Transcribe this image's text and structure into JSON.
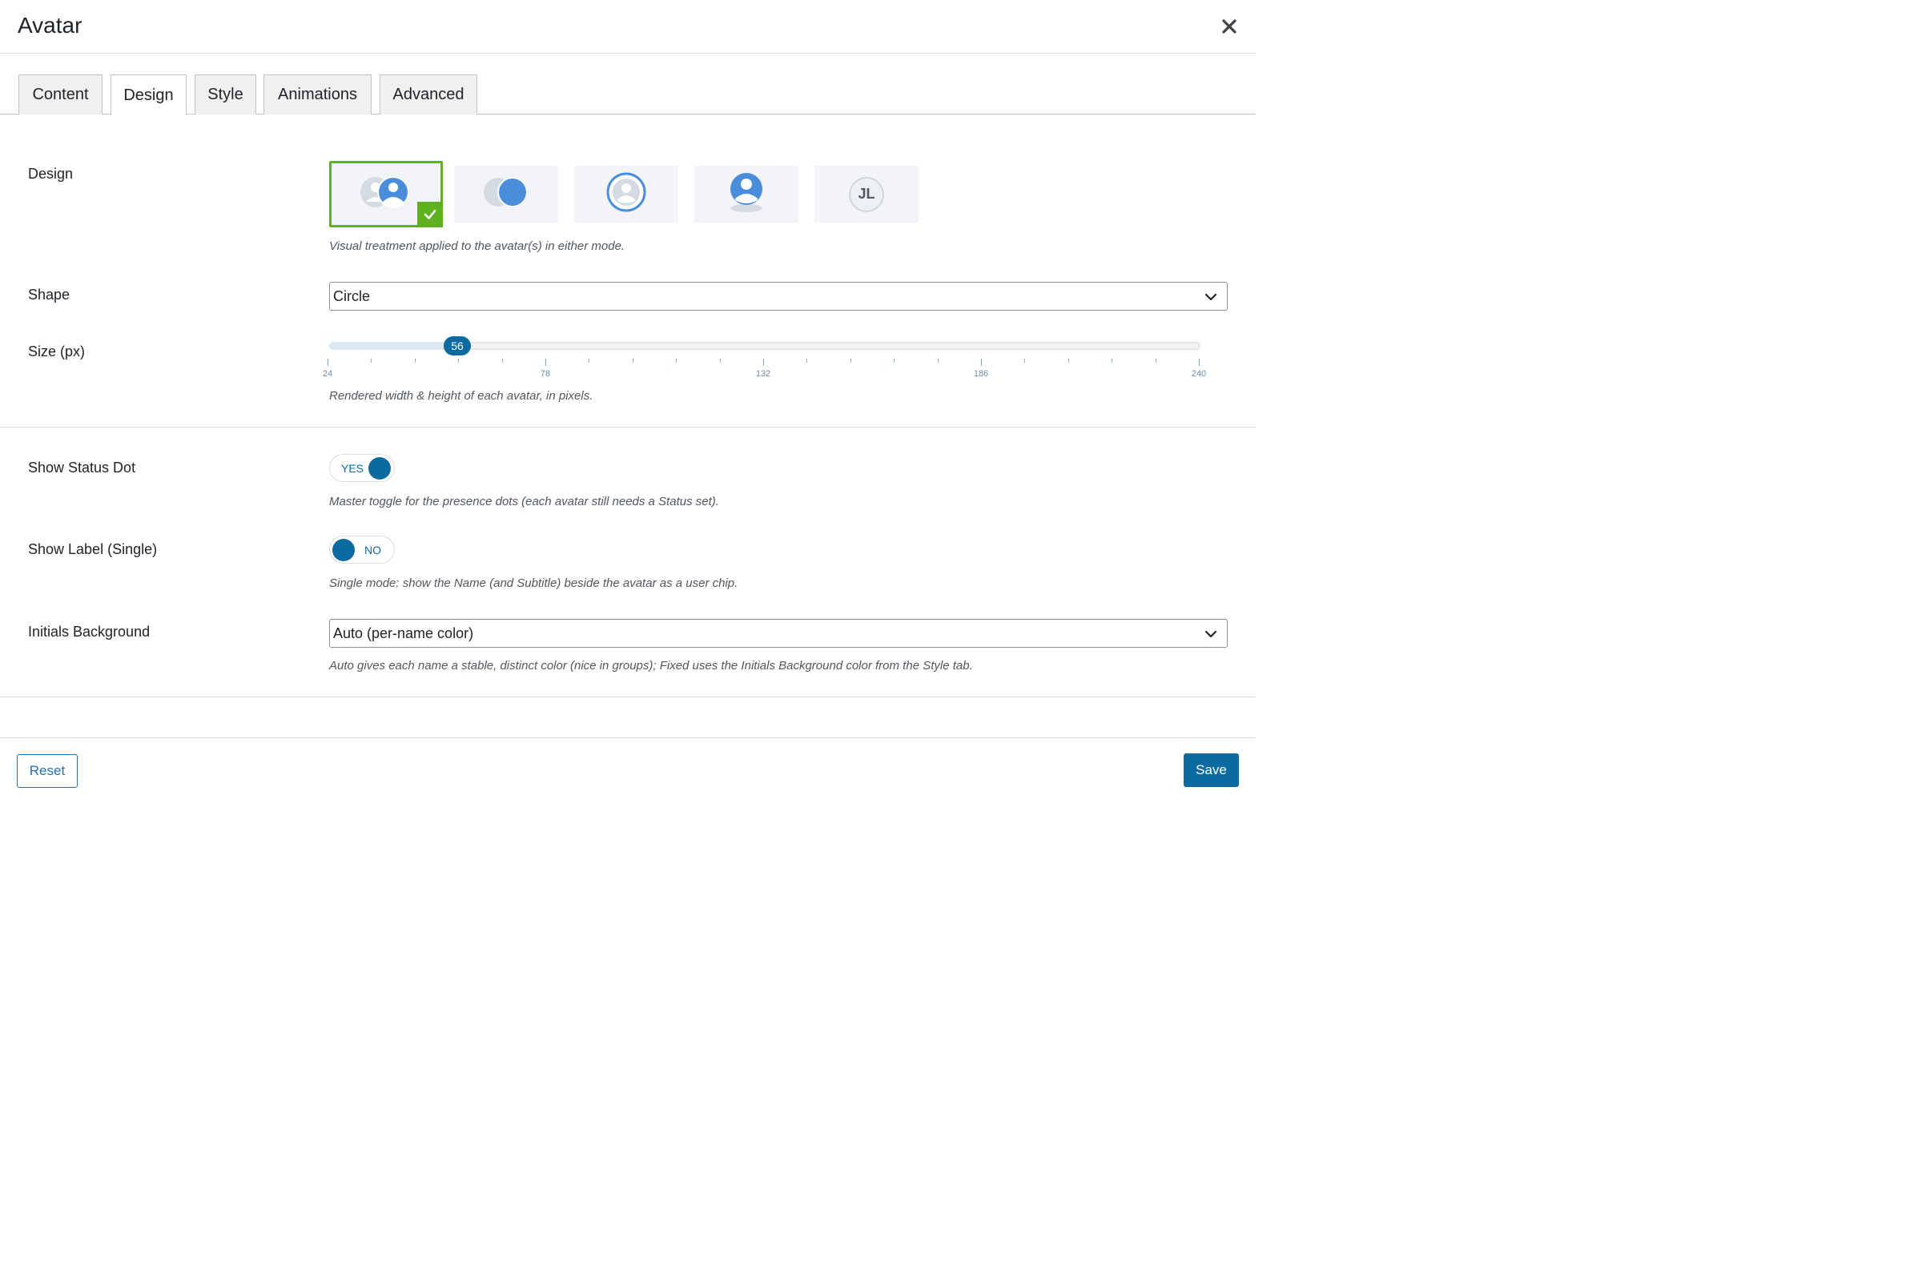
{
  "dialog": {
    "title": "Avatar",
    "close_icon": "close-icon"
  },
  "tabs": [
    {
      "label": "Content",
      "active": false
    },
    {
      "label": "Design",
      "active": true
    },
    {
      "label": "Style",
      "active": false
    },
    {
      "label": "Animations",
      "active": false
    },
    {
      "label": "Advanced",
      "active": false
    }
  ],
  "design": {
    "label": "Design",
    "options": [
      {
        "icon": "avatar-group-icon",
        "selected": true
      },
      {
        "icon": "overlapping-circles-icon",
        "selected": false
      },
      {
        "icon": "ring-avatar-icon",
        "selected": false
      },
      {
        "icon": "shadow-avatar-icon",
        "selected": false
      },
      {
        "icon": "initials-avatar-icon",
        "text": "JL",
        "selected": false
      }
    ],
    "description": "Visual treatment applied to the avatar(s) in either mode."
  },
  "shape": {
    "label": "Shape",
    "value": "Circle"
  },
  "size": {
    "label": "Size (px)",
    "value": "56",
    "min": 24,
    "max": 240,
    "tick_labels": [
      "24",
      "78",
      "132",
      "186",
      "240"
    ],
    "description": "Rendered width & height of each avatar, in pixels."
  },
  "status_dot": {
    "label": "Show Status Dot",
    "state": "YES",
    "description": "Master toggle for the presence dots (each avatar still needs a Status set)."
  },
  "show_label": {
    "label": "Show Label (Single)",
    "state": "NO",
    "description": "Single mode: show the Name (and Subtitle) beside the avatar as a user chip."
  },
  "initials_bg": {
    "label": "Initials Background",
    "value": "Auto (per-name color)",
    "description": "Auto gives each name a stable, distinct color (nice in groups); Fixed uses the Initials Background color from the Style tab."
  },
  "footer": {
    "reset_label": "Reset",
    "save_label": "Save"
  },
  "colors": {
    "accent": "#0b6aa0",
    "selected_border": "#5fb11f",
    "avatar_blue": "#4a8ddb"
  }
}
